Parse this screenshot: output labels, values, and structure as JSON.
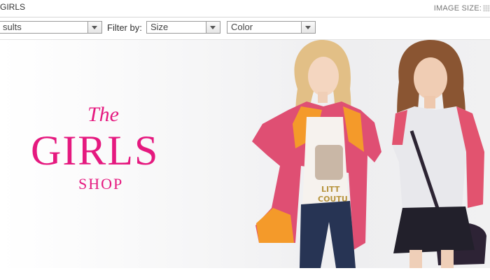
{
  "header": {
    "breadcrumb": "GIRLS",
    "image_size_label": "IMAGE SIZE:"
  },
  "filters": {
    "sort_value": "sults",
    "filter_label": "Filter by:",
    "size_value": "Size",
    "color_value": "Color"
  },
  "hero": {
    "line1": "The",
    "line2": "GIRLS",
    "line3": "SHOP",
    "accent_color": "#e5197f",
    "models_image": "two-girls-photo"
  },
  "icons": [
    "grid-view-icon",
    "dropdown-arrow-icon"
  ]
}
